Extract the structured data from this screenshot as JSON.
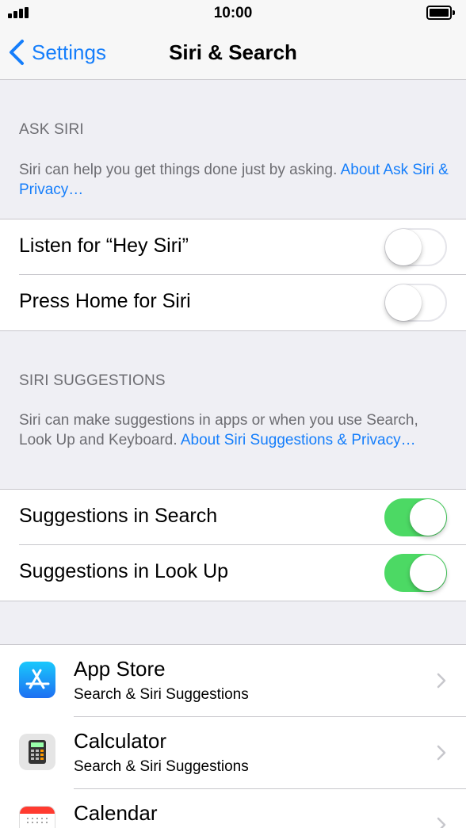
{
  "status_bar": {
    "time": "10:00"
  },
  "nav": {
    "back_label": "Settings",
    "title": "Siri & Search"
  },
  "ask_siri": {
    "header": "ASK SIRI",
    "footer_text": "Siri can help you get things done just by asking. ",
    "footer_link": "About Ask Siri & Privacy…",
    "rows": [
      {
        "label": "Listen for “Hey Siri”",
        "on": false
      },
      {
        "label": "Press Home for Siri",
        "on": false
      }
    ]
  },
  "siri_suggestions": {
    "header": "SIRI SUGGESTIONS",
    "footer_text": "Siri can make suggestions in apps or when you use Search, Look Up and Keyboard. ",
    "footer_link": "About Siri Suggestions & Privacy…",
    "rows": [
      {
        "label": "Suggestions in Search",
        "on": true
      },
      {
        "label": "Suggestions in Look Up",
        "on": true
      }
    ]
  },
  "apps": [
    {
      "name": "App Store",
      "subtitle": "Search & Siri Suggestions",
      "icon": "app-store-icon"
    },
    {
      "name": "Calculator",
      "subtitle": "Search & Siri Suggestions",
      "icon": "calculator-icon"
    },
    {
      "name": "Calendar",
      "subtitle": "",
      "icon": "calendar-icon"
    }
  ],
  "colors": {
    "accent": "#157efb",
    "toggle_on": "#4cd964",
    "background": "#efeff4"
  }
}
